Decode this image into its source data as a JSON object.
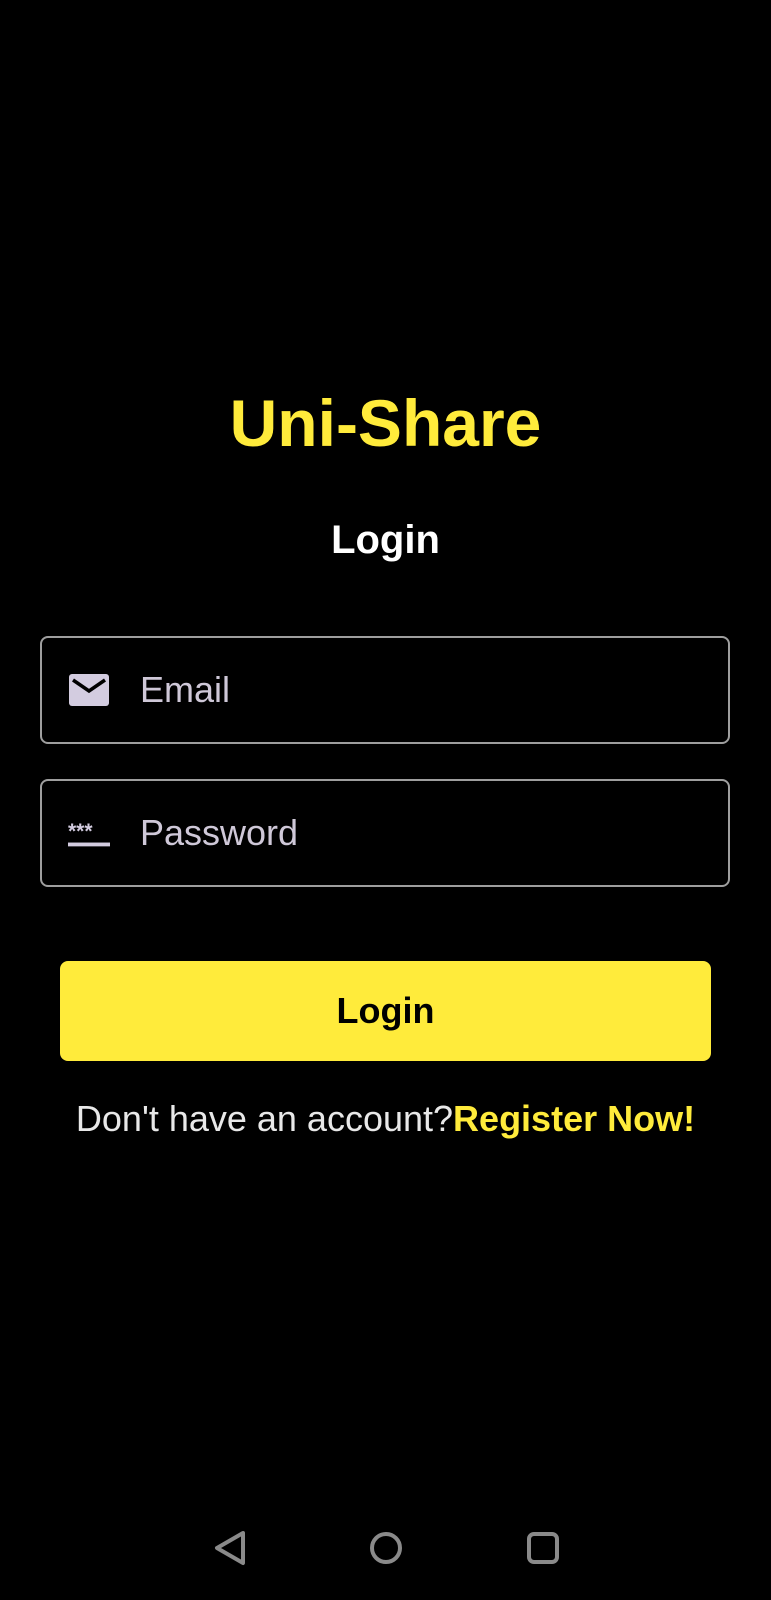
{
  "app_title": "Uni-Share",
  "screen_title": "Login",
  "form": {
    "email": {
      "placeholder": "Email",
      "value": "",
      "icon": "email-icon"
    },
    "password": {
      "placeholder": "Password",
      "value": "",
      "icon": "password-icon"
    },
    "submit_label": "Login"
  },
  "register": {
    "prompt": "Don't have an account?",
    "link": "Register Now!"
  },
  "colors": {
    "accent": "#ffeb3b",
    "background": "#000000"
  },
  "nav_bar": [
    "back-icon",
    "home-icon",
    "recents-icon"
  ]
}
